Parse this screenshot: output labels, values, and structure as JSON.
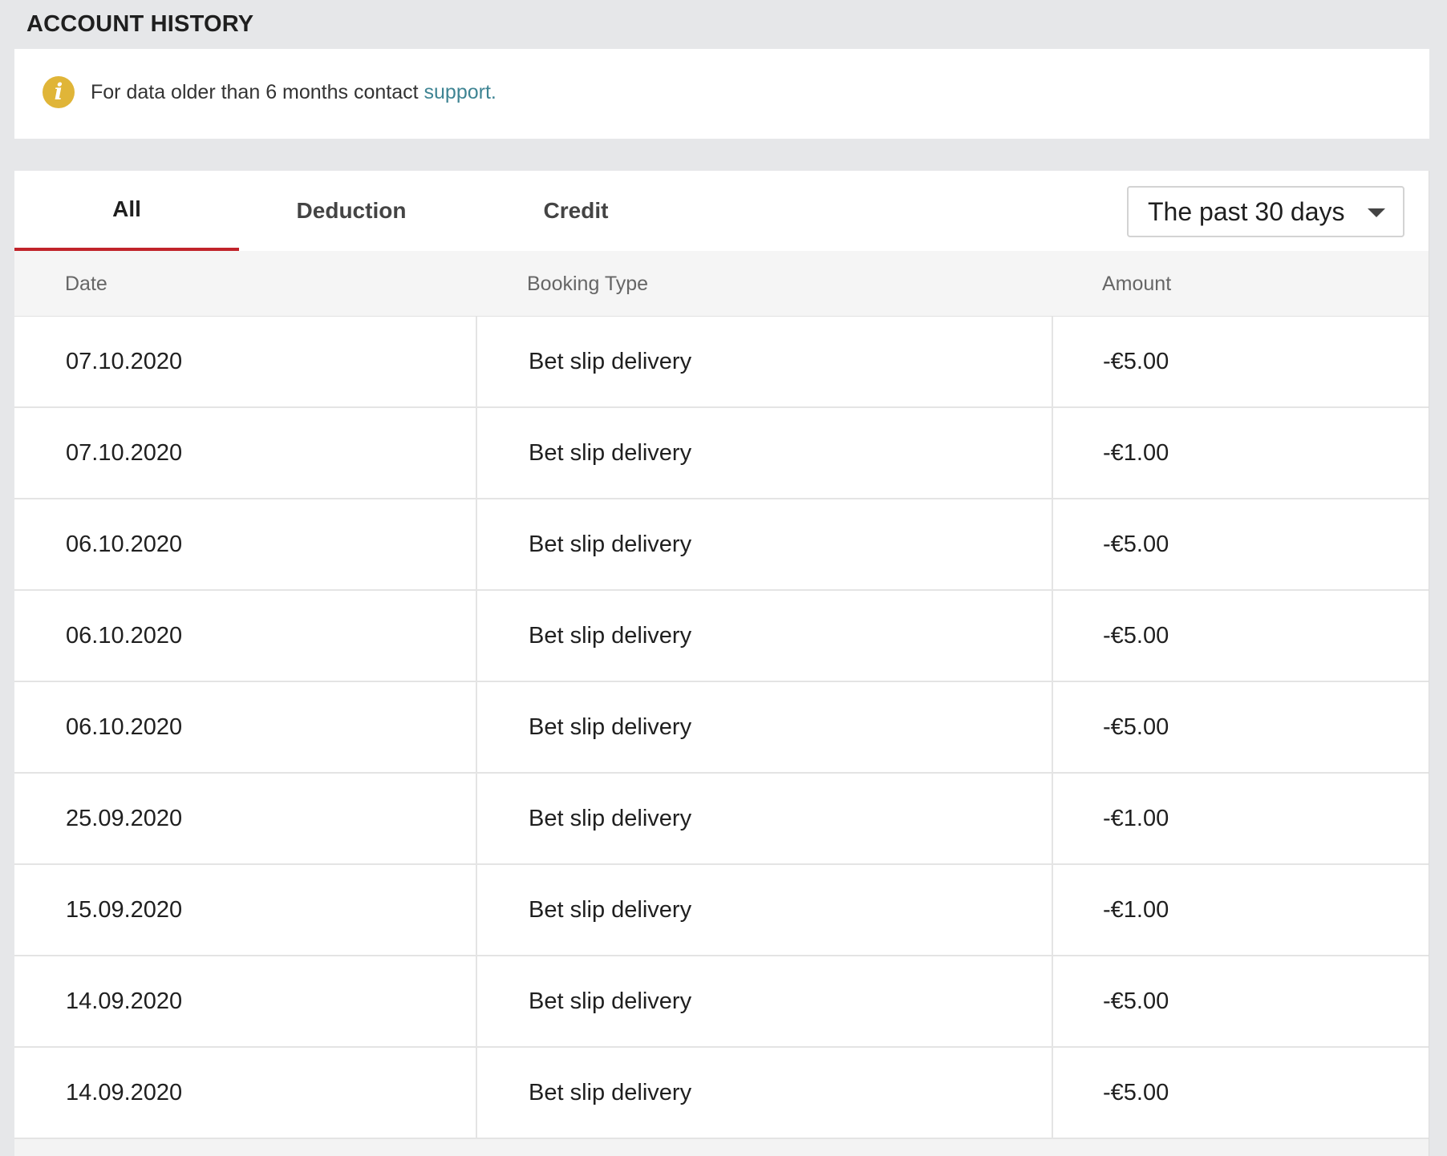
{
  "page": {
    "title": "ACCOUNT HISTORY"
  },
  "notice": {
    "icon": "info-icon",
    "text": "For data older than 6 months contact ",
    "link_text": "support."
  },
  "tabs": [
    {
      "label": "All",
      "active": true
    },
    {
      "label": "Deduction",
      "active": false
    },
    {
      "label": "Credit",
      "active": false
    }
  ],
  "period_select": {
    "selected": "The past 30 days",
    "icon": "caret-down-icon"
  },
  "table": {
    "columns": [
      "Date",
      "Booking Type",
      "Amount"
    ],
    "rows": [
      {
        "date": "07.10.2020",
        "type": "Bet slip delivery",
        "amount": "-€5.00"
      },
      {
        "date": "07.10.2020",
        "type": "Bet slip delivery",
        "amount": "-€1.00"
      },
      {
        "date": "06.10.2020",
        "type": "Bet slip delivery",
        "amount": "-€5.00"
      },
      {
        "date": "06.10.2020",
        "type": "Bet slip delivery",
        "amount": "-€5.00"
      },
      {
        "date": "06.10.2020",
        "type": "Bet slip delivery",
        "amount": "-€5.00"
      },
      {
        "date": "25.09.2020",
        "type": "Bet slip delivery",
        "amount": "-€1.00"
      },
      {
        "date": "15.09.2020",
        "type": "Bet slip delivery",
        "amount": "-€1.00"
      },
      {
        "date": "14.09.2020",
        "type": "Bet slip delivery",
        "amount": "-€5.00"
      },
      {
        "date": "14.09.2020",
        "type": "Bet slip delivery",
        "amount": "-€5.00"
      }
    ]
  },
  "colors": {
    "accent_tab_underline": "#c1232a",
    "link": "#3e8493",
    "info_icon": "#e0b538",
    "page_background": "#e6e7e9"
  }
}
